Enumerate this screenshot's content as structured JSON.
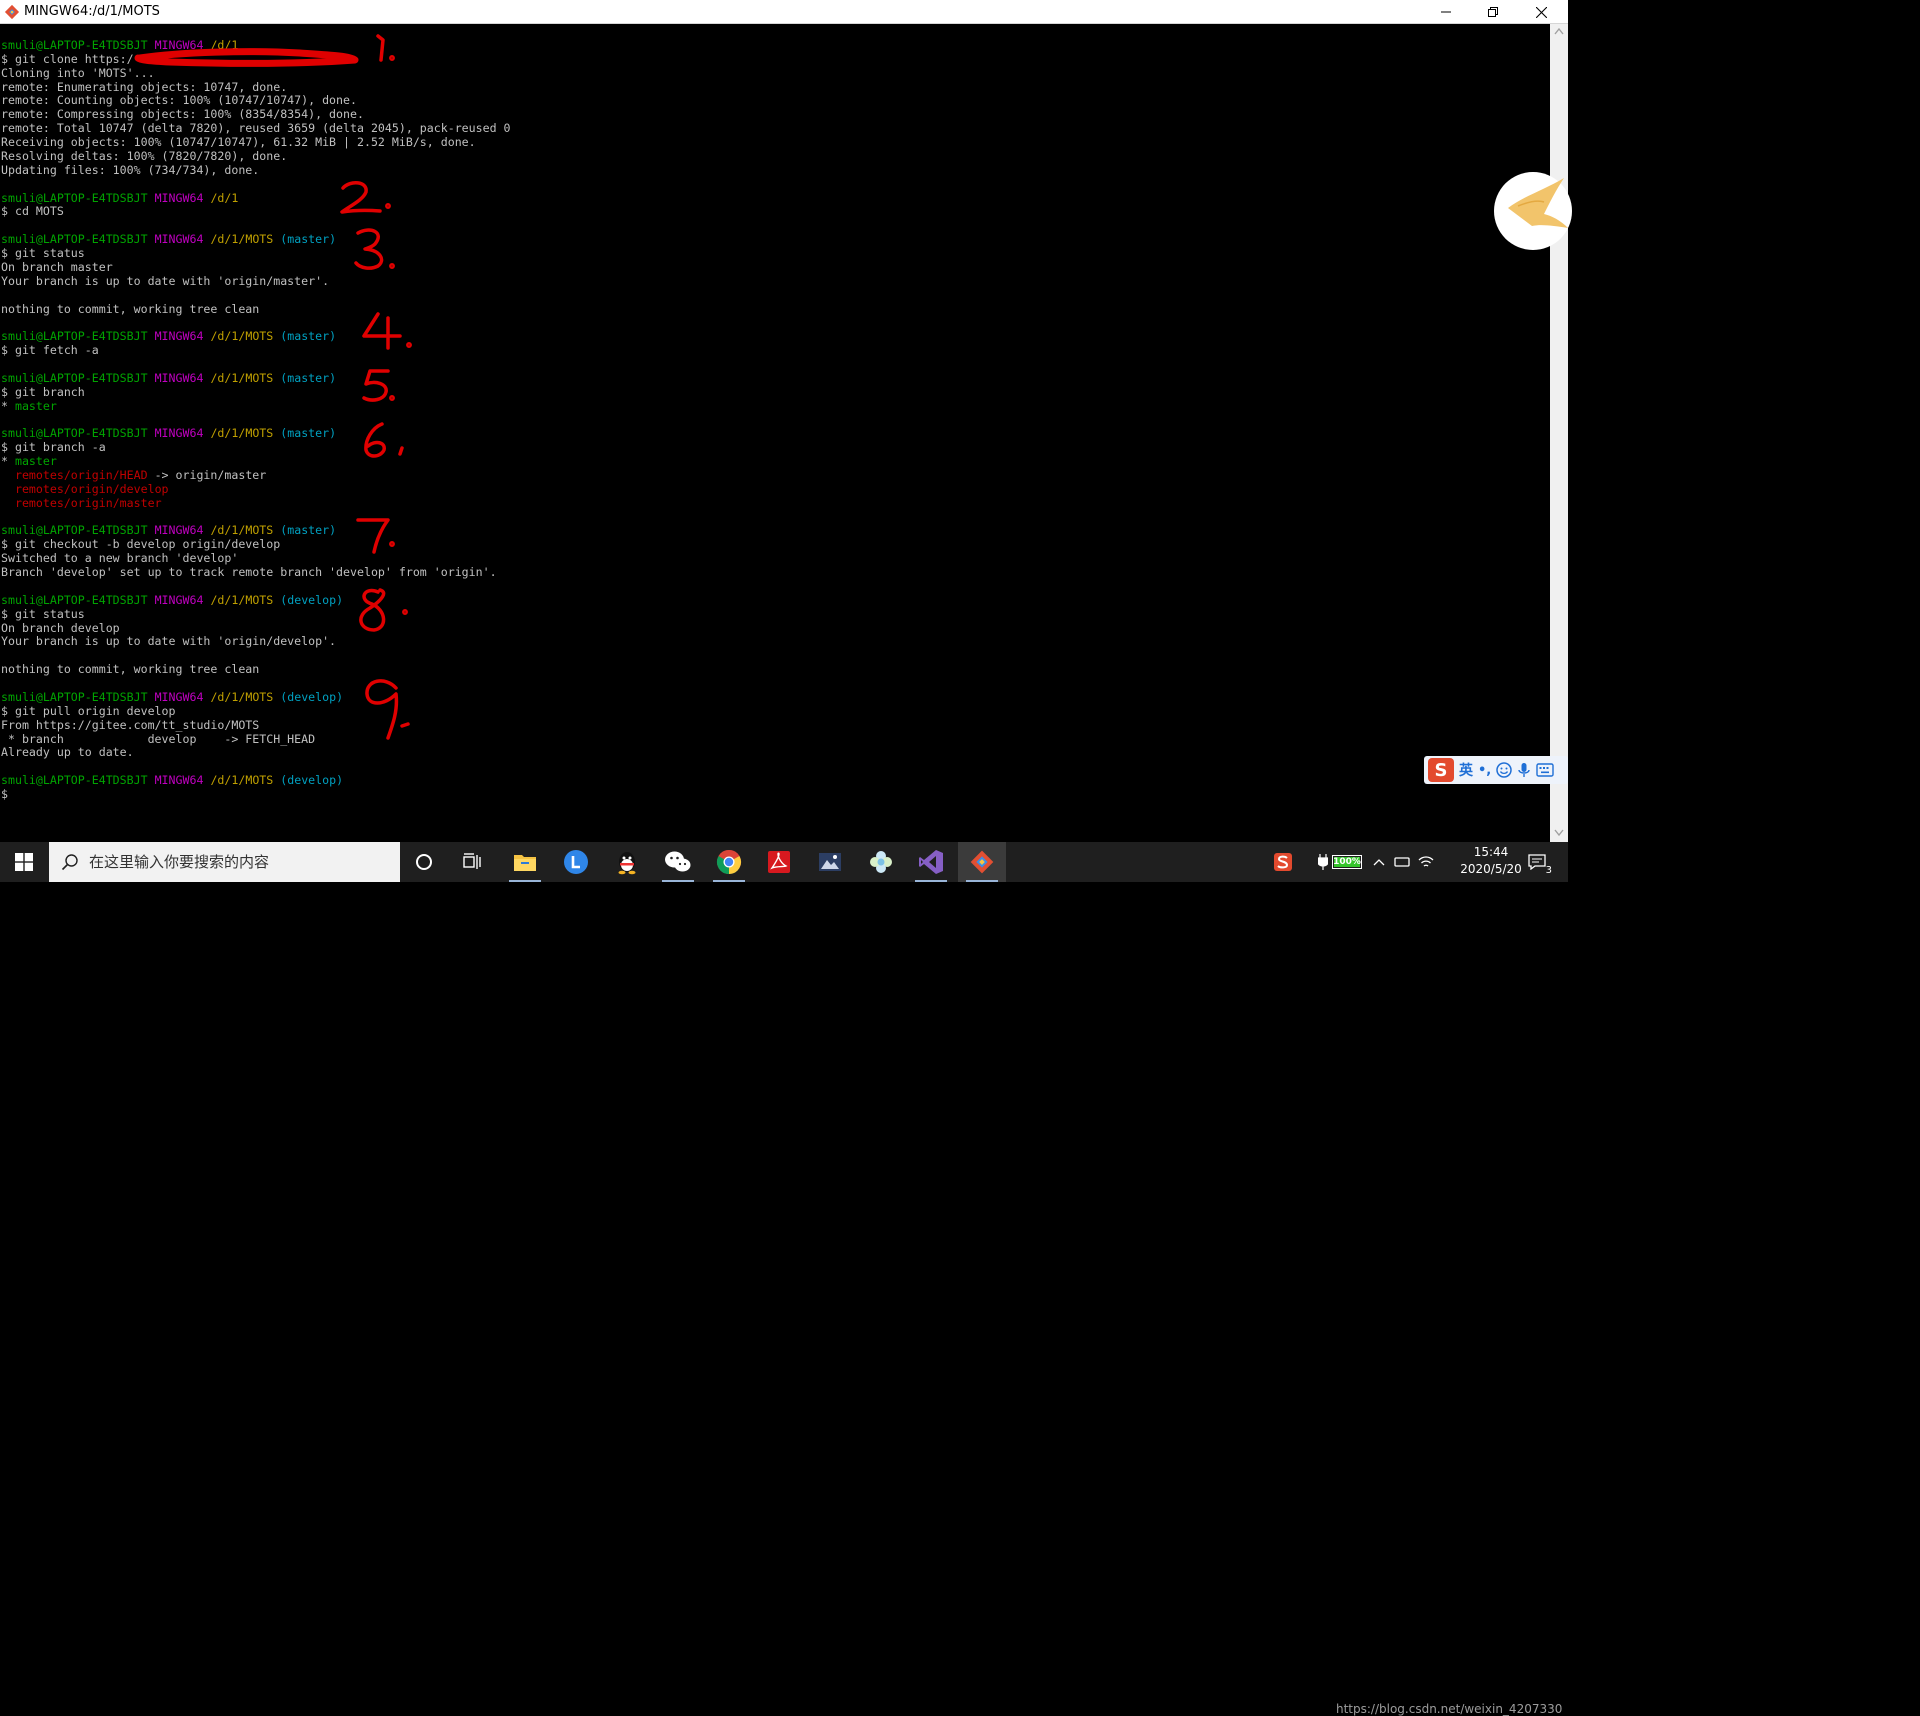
{
  "window": {
    "title": "MINGW64:/d/1/MOTS"
  },
  "terminal": {
    "lines": [
      [
        {
          "t": "smuli@LAPTOP-E4TDSBJT",
          "c": "user"
        },
        {
          "t": " "
        },
        {
          "t": "MINGW64",
          "c": "host"
        },
        {
          "t": " "
        },
        {
          "t": "/d/1",
          "c": "path"
        }
      ],
      [
        {
          "t": "$ git clone https:/"
        }
      ],
      [
        {
          "t": "Cloning into 'MOTS'..."
        }
      ],
      [
        {
          "t": "remote: Enumerating objects: 10747, done."
        }
      ],
      [
        {
          "t": "remote: Counting objects: 100% (10747/10747), done."
        }
      ],
      [
        {
          "t": "remote: Compressing objects: 100% (8354/8354), done."
        }
      ],
      [
        {
          "t": "remote: Total 10747 (delta 7820), reused 3659 (delta 2045), pack-reused 0"
        }
      ],
      [
        {
          "t": "Receiving objects: 100% (10747/10747), 61.32 MiB | 2.52 MiB/s, done."
        }
      ],
      [
        {
          "t": "Resolving deltas: 100% (7820/7820), done."
        }
      ],
      [
        {
          "t": "Updating files: 100% (734/734), done."
        }
      ],
      [
        {
          "t": ""
        }
      ],
      [
        {
          "t": "smuli@LAPTOP-E4TDSBJT",
          "c": "user"
        },
        {
          "t": " "
        },
        {
          "t": "MINGW64",
          "c": "host"
        },
        {
          "t": " "
        },
        {
          "t": "/d/1",
          "c": "path"
        }
      ],
      [
        {
          "t": "$ cd MOTS"
        }
      ],
      [
        {
          "t": ""
        }
      ],
      [
        {
          "t": "smuli@LAPTOP-E4TDSBJT",
          "c": "user"
        },
        {
          "t": " "
        },
        {
          "t": "MINGW64",
          "c": "host"
        },
        {
          "t": " "
        },
        {
          "t": "/d/1/MOTS",
          "c": "path"
        },
        {
          "t": " "
        },
        {
          "t": "(master)",
          "c": "branch"
        }
      ],
      [
        {
          "t": "$ git status"
        }
      ],
      [
        {
          "t": "On branch master"
        }
      ],
      [
        {
          "t": "Your branch is up to date with 'origin/master'."
        }
      ],
      [
        {
          "t": ""
        }
      ],
      [
        {
          "t": "nothing to commit, working tree clean"
        }
      ],
      [
        {
          "t": ""
        }
      ],
      [
        {
          "t": "smuli@LAPTOP-E4TDSBJT",
          "c": "user"
        },
        {
          "t": " "
        },
        {
          "t": "MINGW64",
          "c": "host"
        },
        {
          "t": " "
        },
        {
          "t": "/d/1/MOTS",
          "c": "path"
        },
        {
          "t": " "
        },
        {
          "t": "(master)",
          "c": "branch"
        }
      ],
      [
        {
          "t": "$ git fetch -a"
        }
      ],
      [
        {
          "t": ""
        }
      ],
      [
        {
          "t": "smuli@LAPTOP-E4TDSBJT",
          "c": "user"
        },
        {
          "t": " "
        },
        {
          "t": "MINGW64",
          "c": "host"
        },
        {
          "t": " "
        },
        {
          "t": "/d/1/MOTS",
          "c": "path"
        },
        {
          "t": " "
        },
        {
          "t": "(master)",
          "c": "branch"
        }
      ],
      [
        {
          "t": "$ git branch"
        }
      ],
      [
        {
          "t": "* "
        },
        {
          "t": "master",
          "c": "cur"
        }
      ],
      [
        {
          "t": ""
        }
      ],
      [
        {
          "t": "smuli@LAPTOP-E4TDSBJT",
          "c": "user"
        },
        {
          "t": " "
        },
        {
          "t": "MINGW64",
          "c": "host"
        },
        {
          "t": " "
        },
        {
          "t": "/d/1/MOTS",
          "c": "path"
        },
        {
          "t": " "
        },
        {
          "t": "(master)",
          "c": "branch"
        }
      ],
      [
        {
          "t": "$ git branch -a"
        }
      ],
      [
        {
          "t": "* "
        },
        {
          "t": "master",
          "c": "cur"
        }
      ],
      [
        {
          "t": "  "
        },
        {
          "t": "remotes/origin/HEAD",
          "c": "remote"
        },
        {
          "t": " -> origin/master"
        }
      ],
      [
        {
          "t": "  "
        },
        {
          "t": "remotes/origin/develop",
          "c": "remote"
        }
      ],
      [
        {
          "t": "  "
        },
        {
          "t": "remotes/origin/master",
          "c": "remote"
        }
      ],
      [
        {
          "t": ""
        }
      ],
      [
        {
          "t": "smuli@LAPTOP-E4TDSBJT",
          "c": "user"
        },
        {
          "t": " "
        },
        {
          "t": "MINGW64",
          "c": "host"
        },
        {
          "t": " "
        },
        {
          "t": "/d/1/MOTS",
          "c": "path"
        },
        {
          "t": " "
        },
        {
          "t": "(master)",
          "c": "branch"
        }
      ],
      [
        {
          "t": "$ git checkout -b develop origin/develop"
        }
      ],
      [
        {
          "t": "Switched to a new branch 'develop'"
        }
      ],
      [
        {
          "t": "Branch 'develop' set up to track remote branch 'develop' from 'origin'."
        }
      ],
      [
        {
          "t": ""
        }
      ],
      [
        {
          "t": "smuli@LAPTOP-E4TDSBJT",
          "c": "user"
        },
        {
          "t": " "
        },
        {
          "t": "MINGW64",
          "c": "host"
        },
        {
          "t": " "
        },
        {
          "t": "/d/1/MOTS",
          "c": "path"
        },
        {
          "t": " "
        },
        {
          "t": "(develop)",
          "c": "branch"
        }
      ],
      [
        {
          "t": "$ git status"
        }
      ],
      [
        {
          "t": "On branch develop"
        }
      ],
      [
        {
          "t": "Your branch is up to date with 'origin/develop'."
        }
      ],
      [
        {
          "t": ""
        }
      ],
      [
        {
          "t": "nothing to commit, working tree clean"
        }
      ],
      [
        {
          "t": ""
        }
      ],
      [
        {
          "t": "smuli@LAPTOP-E4TDSBJT",
          "c": "user"
        },
        {
          "t": " "
        },
        {
          "t": "MINGW64",
          "c": "host"
        },
        {
          "t": " "
        },
        {
          "t": "/d/1/MOTS",
          "c": "path"
        },
        {
          "t": " "
        },
        {
          "t": "(develop)",
          "c": "branch"
        }
      ],
      [
        {
          "t": "$ git pull origin develop"
        }
      ],
      [
        {
          "t": "From https://gitee.com/tt_studio/MOTS"
        }
      ],
      [
        {
          "t": " * branch            develop    -> FETCH_HEAD"
        }
      ],
      [
        {
          "t": "Already up to date."
        }
      ],
      [
        {
          "t": ""
        }
      ],
      [
        {
          "t": "smuli@LAPTOP-E4TDSBJT",
          "c": "user"
        },
        {
          "t": " "
        },
        {
          "t": "MINGW64",
          "c": "host"
        },
        {
          "t": " "
        },
        {
          "t": "/d/1/MOTS",
          "c": "path"
        },
        {
          "t": " "
        },
        {
          "t": "(develop)",
          "c": "branch"
        }
      ],
      [
        {
          "t": "$"
        }
      ]
    ],
    "colors": {
      "user": "#00a400",
      "host": "#c000c0",
      "path": "#c0a000",
      "branch": "#00a0c0",
      "cur": "#00a400",
      "remote": "#c00000",
      "text": "#c0c0c0"
    }
  },
  "annotations": {
    "numbers": [
      "1.",
      "2.",
      "3.",
      "4.",
      "5.",
      "6.",
      "7.",
      "8.",
      "9."
    ],
    "color": "#e00000"
  },
  "ime": {
    "logo": "S",
    "language": "英",
    "punct": "•,",
    "icons": [
      "smiley-icon",
      "microphone-icon",
      "keyboard-icon"
    ]
  },
  "taskbar": {
    "search_placeholder": "在这里输入你要搜索的内容",
    "apps": [
      "cortana-icon",
      "task-view-icon",
      "file-explorer-icon",
      "l-app-icon",
      "qq-icon",
      "wechat-icon",
      "chrome-icon",
      "pdf-reader-icon",
      "photo-app-icon",
      "flower-app-icon",
      "visual-studio-icon",
      "git-bash-icon"
    ],
    "battery": "100%",
    "time": "15:44",
    "date": "2020/5/20",
    "notification_count": "3"
  },
  "watermark": "https://blog.csdn.net/weixin_4207330"
}
